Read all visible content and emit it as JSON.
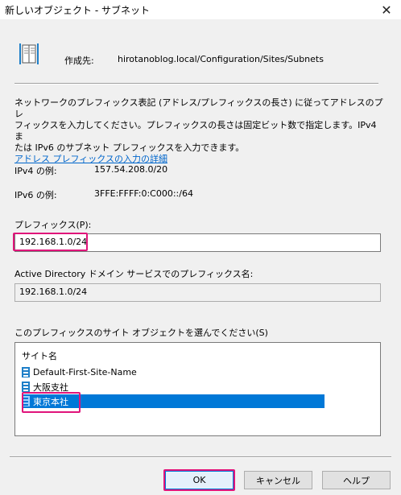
{
  "window": {
    "title": "新しいオブジェクト - サブネット",
    "close_glyph": "✕"
  },
  "header": {
    "create_in_label": "作成先:",
    "create_in_path": "hirotanoblog.local/Configuration/Sites/Subnets"
  },
  "description": {
    "line1": "ネットワークのプレフィックス表記 (アドレス/プレフィックスの長さ) に従ってアドレスのプレ",
    "line2": "フィックスを入力してください。プレフィックスの長さは固定ビット数で指定します。IPv4 ま",
    "line3": "たは IPv6 のサブネット プレフィックスを入力できます。",
    "link": "アドレス プレフィックスの入力の詳細"
  },
  "examples": {
    "ipv4_label": "IPv4 の例:",
    "ipv4_value": "157.54.208.0/20",
    "ipv6_label": "IPv6 の例:",
    "ipv6_value": "3FFE:FFFF:0:C000::/64"
  },
  "prefix": {
    "label": "プレフィックス(P):",
    "value": "192.168.1.0/24"
  },
  "ad_prefix": {
    "label": "Active Directory ドメイン サービスでのプレフィックス名:",
    "value": "192.168.1.0/24"
  },
  "sites": {
    "label": "このプレフィックスのサイト オブジェクトを選んでください(S)",
    "column": "サイト名",
    "items": [
      {
        "name": "Default-First-Site-Name"
      },
      {
        "name": "大阪支社"
      },
      {
        "name": "東京本社"
      }
    ]
  },
  "buttons": {
    "ok": "OK",
    "cancel": "キャンセル",
    "help": "ヘルプ"
  },
  "colors": {
    "selection": "#0078d7",
    "highlight": "#e0147a",
    "link": "#0066cc"
  }
}
